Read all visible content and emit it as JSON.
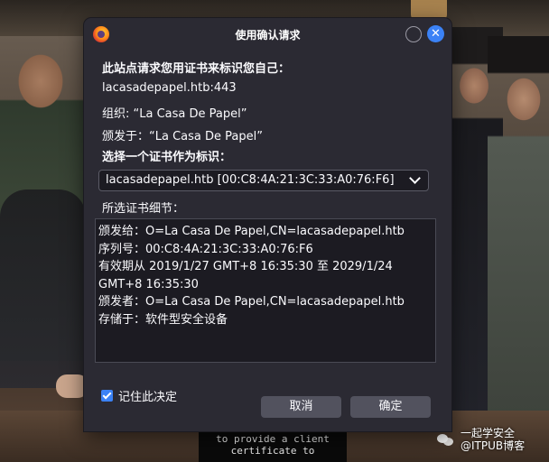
{
  "dialog": {
    "title": "使用确认请求",
    "prompt": "此站点请求您用证书来标识您自己：",
    "host": "lacasadepapel.htb:443",
    "organization": "组织: “La Casa De Papel”",
    "issued_under": "颁发于：“La Casa De Papel”",
    "select_label": "选择一个证书作为标识：",
    "selected_certificate": "lacasadepapel.htb [00:C8:4A:21:3C:33:A0:76:F6]",
    "details_label": "所选证书细节：",
    "details_lines": [
      "颁发给：O=La Casa De Papel,CN=lacasadepapel.htb",
      "序列号：00:C8:4A:21:3C:33:A0:76:F6",
      "有效期从 2019/1/27 GMT+8 16:35:30 至 2029/1/24",
      "GMT+8 16:35:30",
      "颁发者：O=La Casa De Papel,CN=lacasadepapel.htb",
      "存储于：软件型安全设备"
    ],
    "remember_label": "记住此决定",
    "remember_checked": true,
    "cancel_label": "取消",
    "ok_label": "确定",
    "close_glyph": "✕",
    "accent_color": "#3b82f6"
  },
  "terminal": {
    "lines": [
      "to provide a client",
      "certificate to"
    ]
  },
  "watermark": {
    "line1": "一起学安全",
    "line2": "@ITPUB博客"
  }
}
